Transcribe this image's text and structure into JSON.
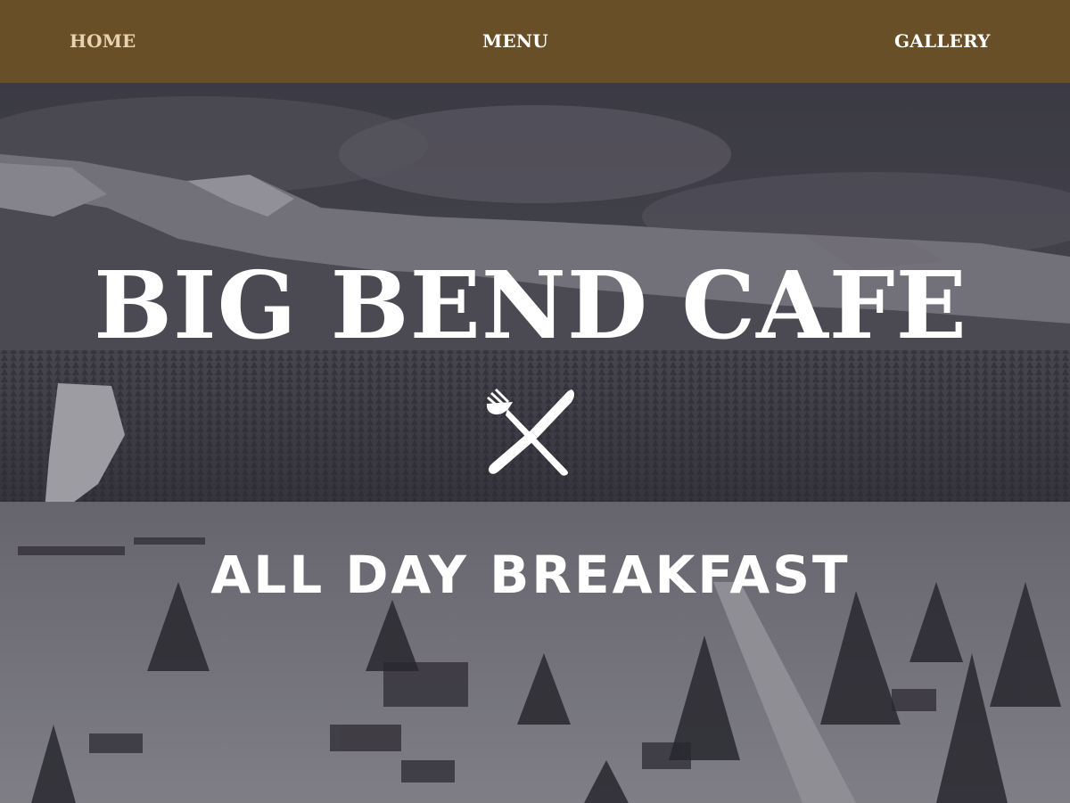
{
  "nav": {
    "items": [
      {
        "label": "HOME",
        "color": "#e8d3b0"
      },
      {
        "label": "MENU",
        "color": "#ffffff"
      },
      {
        "label": "GALLERY",
        "color": "#ffffff"
      }
    ],
    "background": "#694f27"
  },
  "hero": {
    "title": "BIG BEND CAFE",
    "emblem_icon": "crossed-fork-knife-icon",
    "subtitle": "ALL DAY BREAKFAST",
    "background_description_icon": "snowy-mountain-town-photo"
  }
}
